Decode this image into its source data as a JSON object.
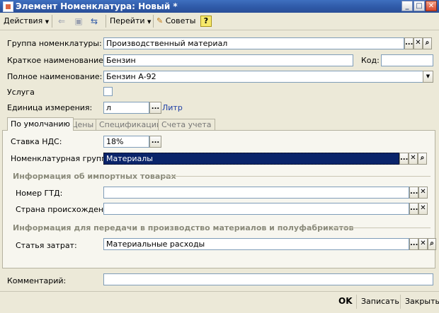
{
  "window": {
    "title": "Элемент Номенклатура: Новый *",
    "minimize": "_",
    "maximize": "□",
    "close": "✕"
  },
  "toolbar": {
    "actions": "Действия",
    "goto": "Перейти",
    "tips": "Советы",
    "help": "?"
  },
  "form": {
    "group_label": "Группа номенклатуры:",
    "group_value": "Производственный материал",
    "short_name_label": "Краткое наименование:",
    "short_name_value": "Бензин",
    "code_label": "Код:",
    "code_value": "",
    "full_name_label": "Полное наименование:",
    "full_name_value": "Бензин А-92",
    "service_label": "Услуга",
    "unit_label": "Единица измерения:",
    "unit_value": "л",
    "unit_link": "Литр"
  },
  "tabs": [
    {
      "label": "По умолчанию",
      "active": true
    },
    {
      "label": "Цены",
      "active": false
    },
    {
      "label": "Спецификации",
      "active": false
    },
    {
      "label": "Счета учета",
      "active": false
    }
  ],
  "defaults_tab": {
    "vat_label": "Ставка НДС:",
    "vat_value": "18%",
    "nom_group_label": "Номенклатурная группа:",
    "nom_group_value": "Материалы",
    "import_section": "Информация об импортных товарах",
    "gtd_label": "Номер ГТД:",
    "gtd_value": "",
    "country_label": "Страна происхождения:",
    "country_value": "",
    "production_section": "Информация для передачи в производство материалов и полуфабрикатов",
    "cost_item_label": "Статья затрат:",
    "cost_item_value": "Материальные расходы"
  },
  "comment": {
    "label": "Комментарий:",
    "value": ""
  },
  "footer": {
    "ok": "OK",
    "save": "Записать",
    "close": "Закрыть"
  },
  "icons": {
    "dropdown": "▼",
    "select": "...",
    "clear": "✕",
    "open": "⌕"
  }
}
